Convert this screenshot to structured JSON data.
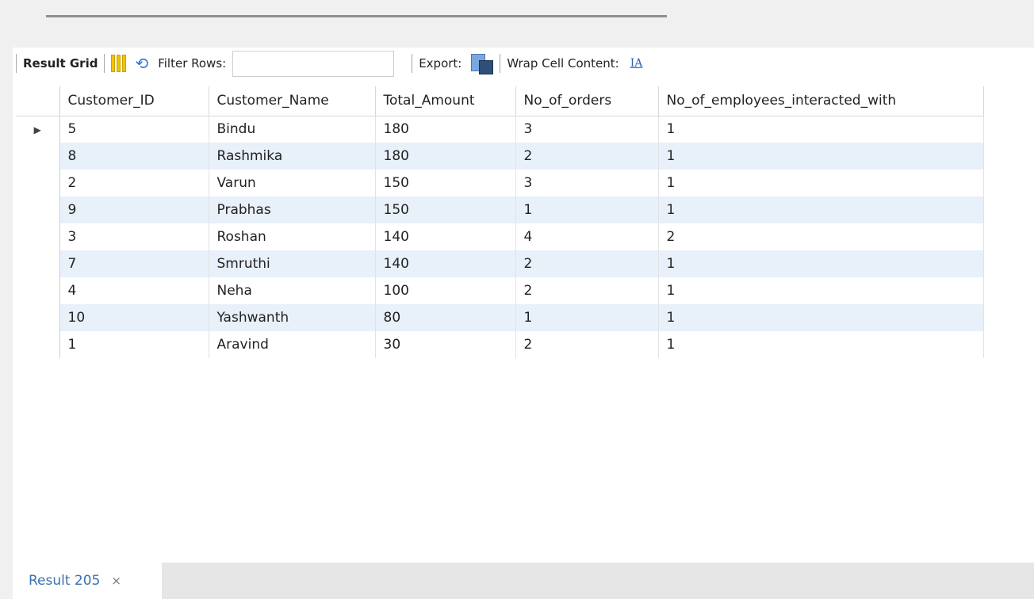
{
  "toolbar": {
    "result_grid_label": "Result Grid",
    "filter_rows_label": "Filter Rows:",
    "filter_rows_value": "",
    "export_label": "Export:",
    "wrap_cell_label": "Wrap Cell Content:",
    "wrap_icon_glyph": "IA"
  },
  "table": {
    "columns": [
      "Customer_ID",
      "Customer_Name",
      "Total_Amount",
      "No_of_orders",
      "No_of_employees_interacted_with"
    ],
    "rows": [
      [
        "5",
        "Bindu",
        "180",
        "3",
        "1"
      ],
      [
        "8",
        "Rashmika",
        "180",
        "2",
        "1"
      ],
      [
        "2",
        "Varun",
        "150",
        "3",
        "1"
      ],
      [
        "9",
        "Prabhas",
        "150",
        "1",
        "1"
      ],
      [
        "3",
        "Roshan",
        "140",
        "4",
        "2"
      ],
      [
        "7",
        "Smruthi",
        "140",
        "2",
        "1"
      ],
      [
        "4",
        "Neha",
        "100",
        "2",
        "1"
      ],
      [
        "10",
        "Yashwanth",
        "80",
        "1",
        "1"
      ],
      [
        "1",
        "Aravind",
        "30",
        "2",
        "1"
      ]
    ],
    "current_row_marker": "▶"
  },
  "tabs": [
    {
      "label": "Result 205",
      "close": "×"
    }
  ]
}
